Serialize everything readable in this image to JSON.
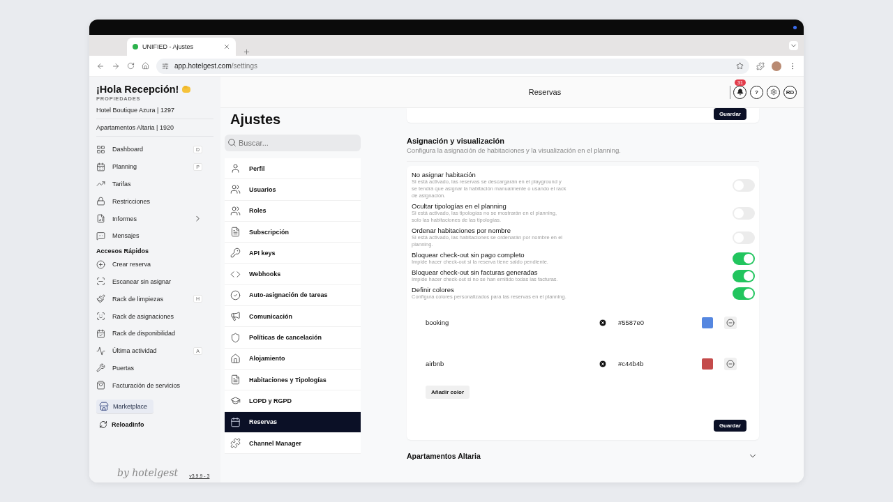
{
  "browser": {
    "tab_title": "UNIFIED - Ajustes",
    "url_host": "app.hotelgest.com",
    "url_path": "/settings"
  },
  "sidebar": {
    "greeting": "¡Hola Recepción!",
    "properties_label": "PROPIEDADES",
    "properties": [
      "Hotel Boutique Azura | 1297",
      "Apartamentos Altaria | 1920"
    ],
    "nav": [
      {
        "label": "Dashboard",
        "shortcut": "D"
      },
      {
        "label": "Planning",
        "shortcut": "P"
      },
      {
        "label": "Tarifas"
      },
      {
        "label": "Restricciones"
      },
      {
        "label": "Informes",
        "expandable": true
      },
      {
        "label": "Mensajes"
      }
    ],
    "quick_label": "Accesos Rápidos",
    "quick": [
      {
        "label": "Crear reserva"
      },
      {
        "label": "Escanear sin asignar"
      },
      {
        "label": "Rack de limpiezas",
        "shortcut": "H"
      },
      {
        "label": "Rack de asignaciones"
      },
      {
        "label": "Rack de disponibilidad"
      },
      {
        "label": "Última actividad",
        "shortcut": "A"
      },
      {
        "label": "Puertas"
      },
      {
        "label": "Facturación de servicios"
      }
    ],
    "marketplace": "Marketplace",
    "reload": "ReloadInfo",
    "brand": "by hotelgest",
    "version": "v3.9.9 - 3"
  },
  "header": {
    "title": "Reservas",
    "notification_count": "31",
    "help": "?",
    "avatar": "RD"
  },
  "settings": {
    "title": "Ajustes",
    "search_placeholder": "Buscar...",
    "items": [
      {
        "label": "Perfil",
        "selected": false
      },
      {
        "label": "Usuarios",
        "selected": false
      },
      {
        "label": "Roles",
        "selected": false
      },
      {
        "label": "Subscripción",
        "selected": false
      },
      {
        "label": "API keys",
        "selected": false
      },
      {
        "label": "Webhooks",
        "selected": false
      },
      {
        "label": "Auto-asignación de tareas",
        "selected": false
      },
      {
        "label": "Comunicación",
        "selected": false
      },
      {
        "label": "Políticas de cancelación",
        "selected": false
      },
      {
        "label": "Alojamiento",
        "selected": false
      },
      {
        "label": "Habitaciones y Tipologías",
        "selected": false
      },
      {
        "label": "LOPD y RGPD",
        "selected": false
      },
      {
        "label": "Reservas",
        "selected": true
      },
      {
        "label": "Channel Manager",
        "selected": false
      }
    ]
  },
  "content": {
    "top_save": "Guardar",
    "section_title": "Asignación y visualización",
    "section_description": "Configura la asignación de habitaciones y la visualización en el planning.",
    "toggles": [
      {
        "title": "No asignar habitación",
        "description": "Si está activado, las reservas se descargarán en el playground y se tendrá que asignar la habitación manualmente o usando el rack de asignación.",
        "on": false
      },
      {
        "title": "Ocultar tipologías en el planning",
        "description": "Si está activado, las tipologías no se mostrarán en el planning, solo las habitaciones de las tipologías.",
        "on": false
      },
      {
        "title": "Ordenar habitaciones por nombre",
        "description": "Si está activado, las habitaciones se ordenarán por nombre en el planning.",
        "on": false
      },
      {
        "title": "Bloquear check-out sin pago completo",
        "description": "Impide hacer check-out si la reserva tiene saldo pendiente.",
        "on": true
      },
      {
        "title": "Bloquear check-out sin facturas generadas",
        "description": "Impide hacer check-out si no se han emitido todas las facturas.",
        "on": true
      },
      {
        "title": "Definir colores",
        "description": "Configura colores personalizados para las reservas en el planning.",
        "on": true
      }
    ],
    "colors": [
      {
        "name": "booking",
        "value": "#5587e0",
        "color": "#5587e0"
      },
      {
        "name": "airbnb",
        "value": "#c44b4b",
        "color": "#c44b4b"
      }
    ],
    "add_color": "Añadir color",
    "save": "Guardar",
    "accordion": {
      "title": "Apartamentos Altaria",
      "expanded": false
    }
  }
}
